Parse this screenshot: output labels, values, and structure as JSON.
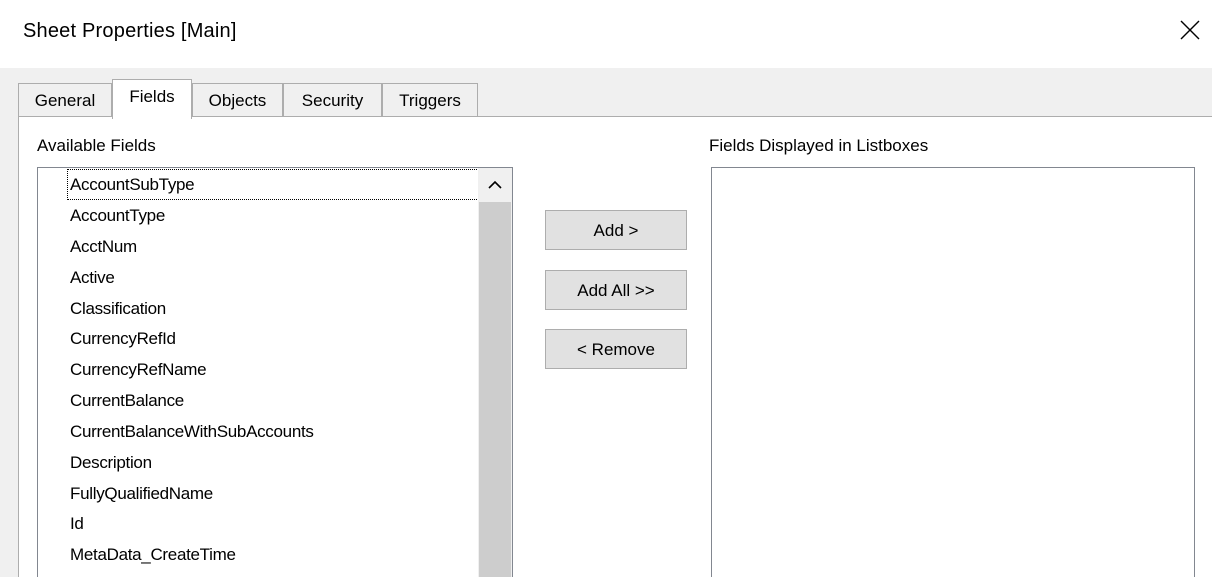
{
  "window": {
    "title": "Sheet Properties [Main]"
  },
  "tabs": [
    {
      "label": "General"
    },
    {
      "label": "Fields"
    },
    {
      "label": "Objects"
    },
    {
      "label": "Security"
    },
    {
      "label": "Triggers"
    }
  ],
  "active_tab": "Fields",
  "available_fields": {
    "label": "Available Fields",
    "items": [
      "AccountSubType",
      "AccountType",
      "AcctNum",
      "Active",
      "Classification",
      "CurrencyRefId",
      "CurrencyRefName",
      "CurrentBalance",
      "CurrentBalanceWithSubAccounts",
      "Description",
      "FullyQualifiedName",
      "Id",
      "MetaData_CreateTime"
    ],
    "focused_item": "AccountSubType"
  },
  "buttons": {
    "add": "Add >",
    "add_all": "Add All >>",
    "remove": "< Remove"
  },
  "displayed_fields": {
    "label": "Fields Displayed in Listboxes",
    "items": []
  },
  "colors": {
    "panel_background": "#f0f0f0",
    "scrollbar_thumb": "#cdcdcd",
    "button_face": "#e1e1e1"
  },
  "icons": {
    "close": "close-icon",
    "scroll_up": "chevron-up-icon"
  }
}
